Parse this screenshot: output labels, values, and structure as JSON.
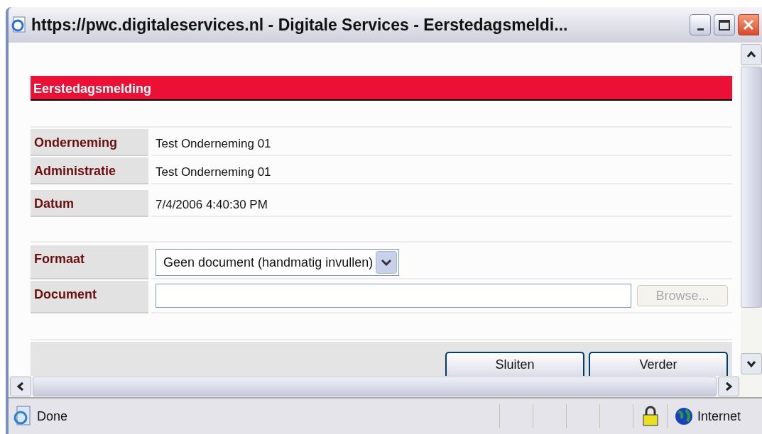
{
  "window": {
    "title": "https://pwc.digitaleservices.nl - Digitale Services - Eerstedagsmeldi..."
  },
  "header": "Eerstedagsmelding",
  "info_rows": [
    {
      "label": "Onderneming",
      "value": "Test Onderneming 01"
    },
    {
      "label": "Administratie",
      "value": "Test Onderneming 01"
    },
    {
      "label": "Datum",
      "value": "7/4/2006 4:40:30 PM"
    }
  ],
  "format": {
    "label": "Formaat",
    "value": "Geen document (handmatig invullen)"
  },
  "document": {
    "label": "Document",
    "browse": {
      "label": "Browse...",
      "disabled": true
    }
  },
  "buttons": [
    "Sluiten",
    "Verder"
  ],
  "status_bar": {
    "text": "Done",
    "zone": "Internet"
  }
}
